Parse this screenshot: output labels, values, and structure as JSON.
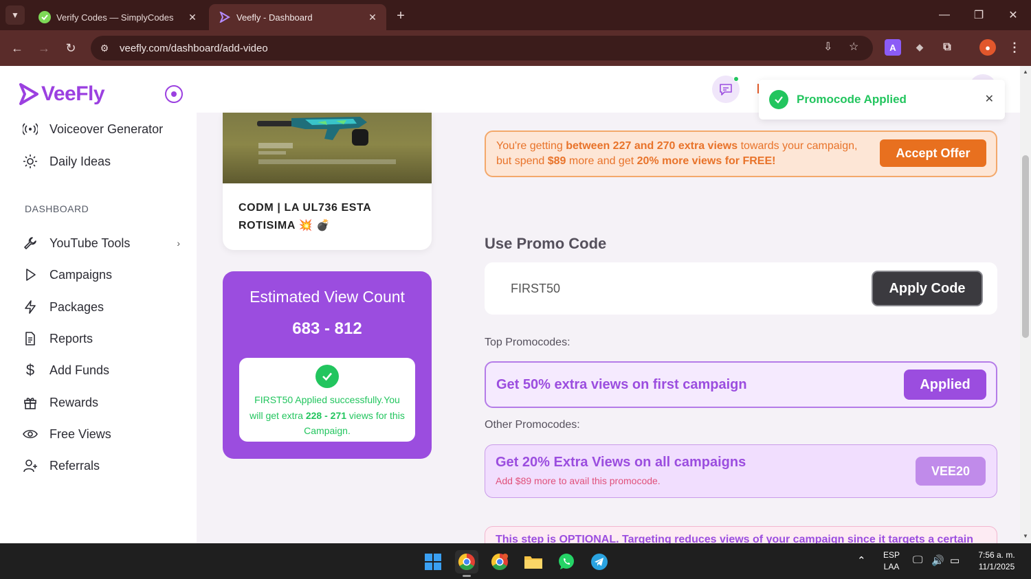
{
  "browser": {
    "tabs": [
      {
        "title": "Verify Codes — SimplyCodes",
        "active": false
      },
      {
        "title": "Veefly - Dashboard",
        "active": true
      }
    ],
    "url": "veefly.com/dashboard/add-video"
  },
  "sidebar": {
    "logo": "VeeFly",
    "section_label": "DASHBOARD",
    "items_top": [
      {
        "label": "Voiceover Generator",
        "icon": "broadcast-icon"
      },
      {
        "label": "Daily Ideas",
        "icon": "sun-icon"
      }
    ],
    "items": [
      {
        "label": "YouTube Tools",
        "icon": "wrench-icon"
      },
      {
        "label": "Campaigns",
        "icon": "play-icon"
      },
      {
        "label": "Packages",
        "icon": "bolt-icon"
      },
      {
        "label": "Reports",
        "icon": "document-icon"
      },
      {
        "label": "Add Funds",
        "icon": "dollar-icon"
      },
      {
        "label": "Rewards",
        "icon": "gift-icon"
      },
      {
        "label": "Free Views",
        "icon": "eye-icon"
      },
      {
        "label": "Referrals",
        "icon": "user-plus-icon"
      }
    ]
  },
  "toast": {
    "message": "Promocode Applied"
  },
  "video": {
    "title": "CODM | LA UL736 ESTA ROTISIMA 💥 💣"
  },
  "estimate": {
    "title": "Estimated View Count",
    "range": "683 - 812",
    "msg_pre": "FIRST50 Applied successfully.You will get extra",
    "msg_range": "228 - 271",
    "msg_post": "views for this Campaign."
  },
  "offer": {
    "text_1": "You're getting",
    "bold_1": "between 227 and 270 extra views",
    "text_2": "towards your campaign, but spend",
    "bold_2": "$89",
    "text_3": "more and get",
    "bold_3": "20% more views for FREE!",
    "button": "Accept Offer"
  },
  "promo": {
    "heading": "Use Promo Code",
    "input_value": "FIRST50",
    "apply_button": "Apply Code",
    "top_label": "Top Promocodes:",
    "top_card": {
      "title": "Get 50% extra views on first campaign",
      "button": "Applied"
    },
    "other_label": "Other Promocodes:",
    "other_card": {
      "title": "Get 20% Extra Views on all campaigns",
      "sub": "Add $89 more to avail this promocode.",
      "code": "VEE20"
    }
  },
  "optional_note": "This step is OPTIONAL. Targeting reduces views of your campaign since it targets a certain",
  "taskbar": {
    "lang_1": "ESP",
    "lang_2": "LAA",
    "time": "7:56 a. m.",
    "date": "11/1/2025"
  },
  "colors": {
    "brand": "#9b4ddf",
    "success": "#22c55e",
    "offer_orange": "#e8701f",
    "chrome_bg": "#3a1b1a"
  }
}
